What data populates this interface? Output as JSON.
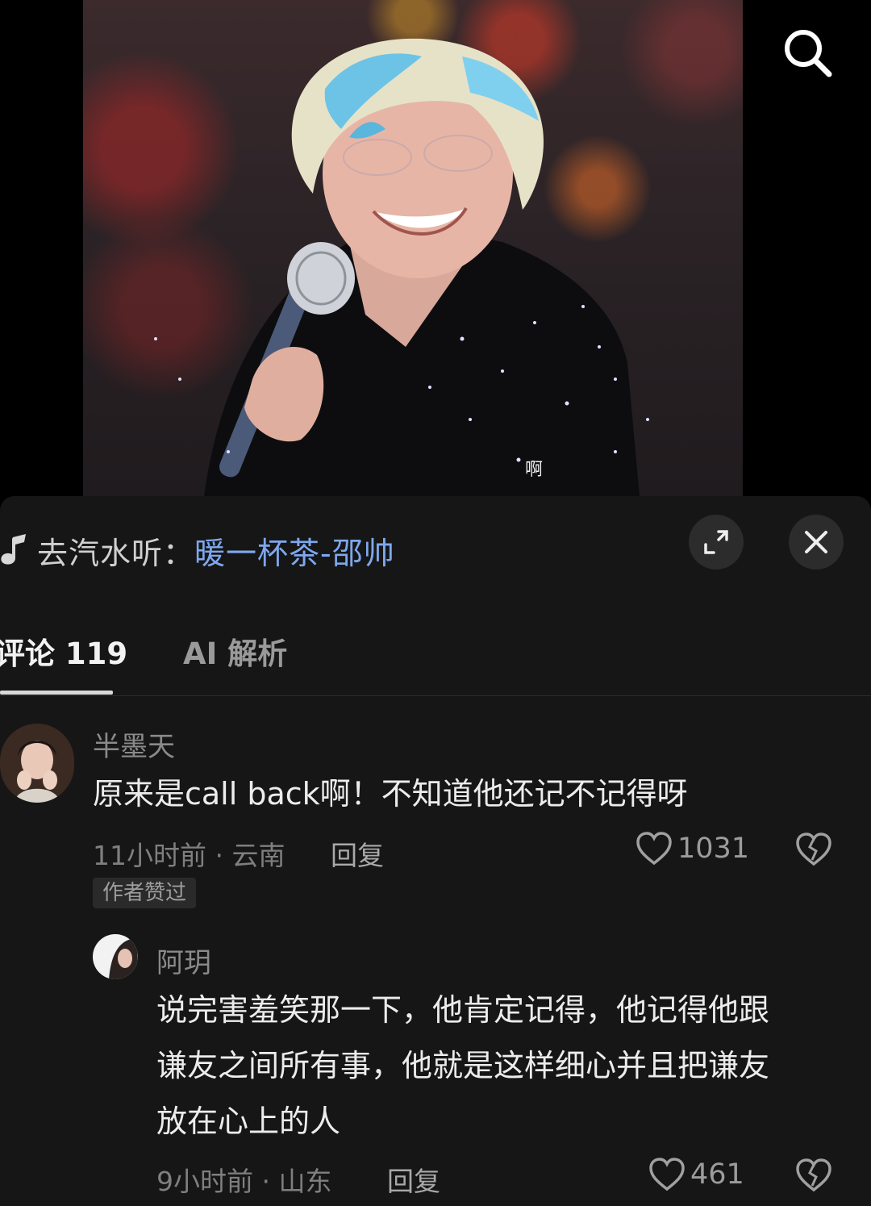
{
  "video": {
    "subtitle": "啊",
    "search_icon": "search-icon"
  },
  "music": {
    "prefix": "去汽水听：",
    "song": "暖一杯茶-邵帅",
    "icon": "music-note-icon"
  },
  "header_buttons": {
    "expand_icon": "expand-icon",
    "close_icon": "close-icon"
  },
  "tabs": [
    {
      "label": "评论 119",
      "active": true
    },
    {
      "label": "AI 解析",
      "active": false
    }
  ],
  "comments": [
    {
      "username": "半墨天",
      "text": "原来是call back啊！不知道他还记不记得呀",
      "meta": "11小时前 · 云南",
      "reply_label": "回复",
      "likes": "1031",
      "badge": "作者赞过"
    },
    {
      "username": "阿玥",
      "text_lines": [
        "说完害羞笑那一下，他肯定记得，他记得他跟",
        "谦友之间所有事，他就是这样细心并且把谦友",
        "放在心上的人"
      ],
      "meta": "9小时前 · 山东",
      "reply_label": "回复",
      "likes": "461"
    }
  ],
  "colors": {
    "sheet_bg": "#161616",
    "song_link": "#7ea8ee",
    "text_primary": "#ececec",
    "text_secondary": "#8a8a8a"
  }
}
